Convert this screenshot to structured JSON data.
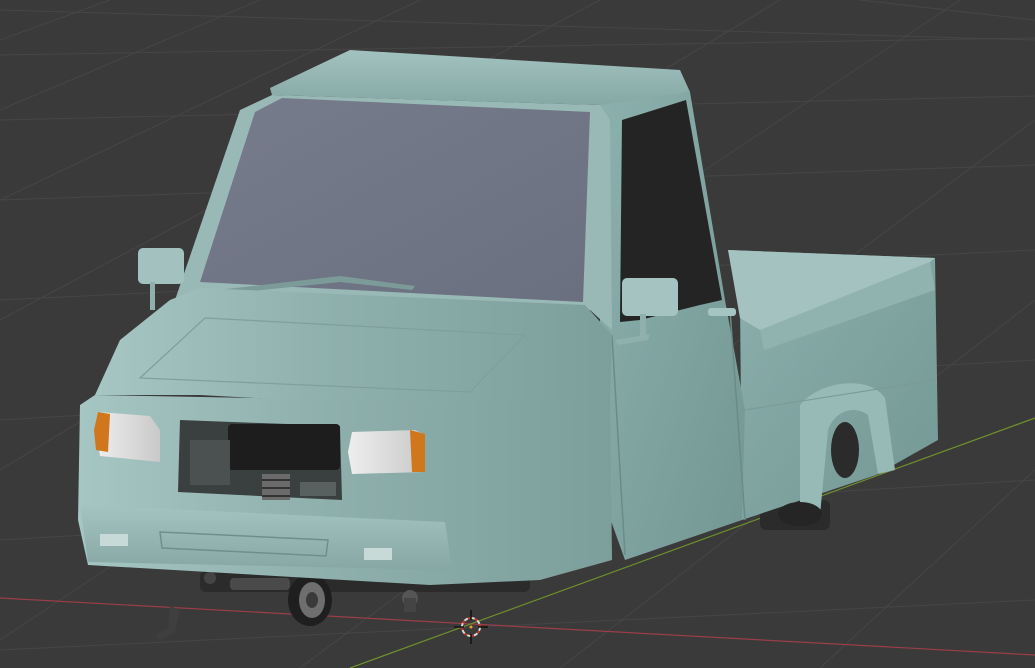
{
  "viewport": {
    "mode": "3d-viewport",
    "shading": "solid",
    "background_color": "#3a3a3a",
    "grid_color": "#474747",
    "x_axis_color": "#9a3e48",
    "y_axis_color": "#6f8f2c"
  },
  "model": {
    "name_icon": "pickup-truck-model",
    "body_color": "#8fb3b0",
    "glass_color": "#6f7585",
    "side_window_color": "#242424",
    "indicator_color": "#d0761c"
  },
  "cursor": {
    "icon": "3d-cursor-icon",
    "ring_outer": "#d9d9d9",
    "ring_inner": "#c0392b"
  }
}
